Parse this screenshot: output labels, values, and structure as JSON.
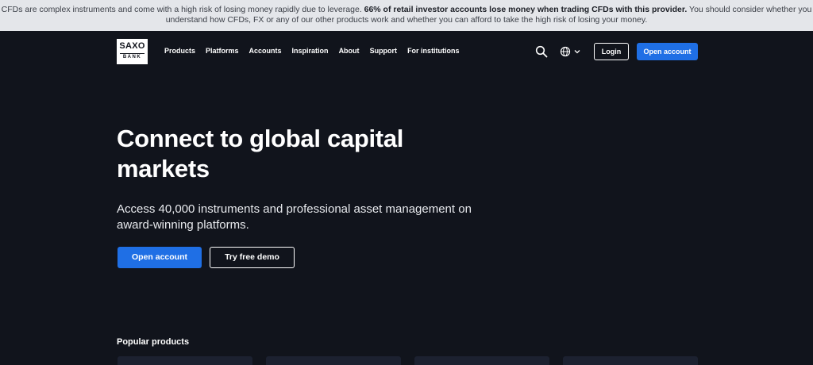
{
  "risk_banner": {
    "text_before": "CFDs are complex instruments and come with a high risk of losing money rapidly due to leverage. ",
    "bold": "66% of retail investor accounts lose money when trading CFDs with this provider.",
    "text_after": " You should consider whether you understand how CFDs, FX or any of our other products work and whether you can afford to take the high risk of losing your money."
  },
  "nav": {
    "logo_top": "SAXO",
    "logo_bottom": "BANK",
    "menu": [
      "Products",
      "Platforms",
      "Accounts",
      "Inspiration",
      "About",
      "Support",
      "For institutions"
    ],
    "search_icon": "search-icon",
    "language_icon": "globe-icon",
    "login_label": "Login",
    "open_account_label": "Open account"
  },
  "hero": {
    "title": "Connect to global capital markets",
    "subtitle": "Access 40,000 instruments and professional asset management on award-winning platforms.",
    "open_account_label": "Open account",
    "demo_label": "Try free demo"
  },
  "popular": {
    "title": "Popular products"
  },
  "colors": {
    "background": "#11141c",
    "accent": "#1f6fe5",
    "banner": "#e4e6ea"
  }
}
